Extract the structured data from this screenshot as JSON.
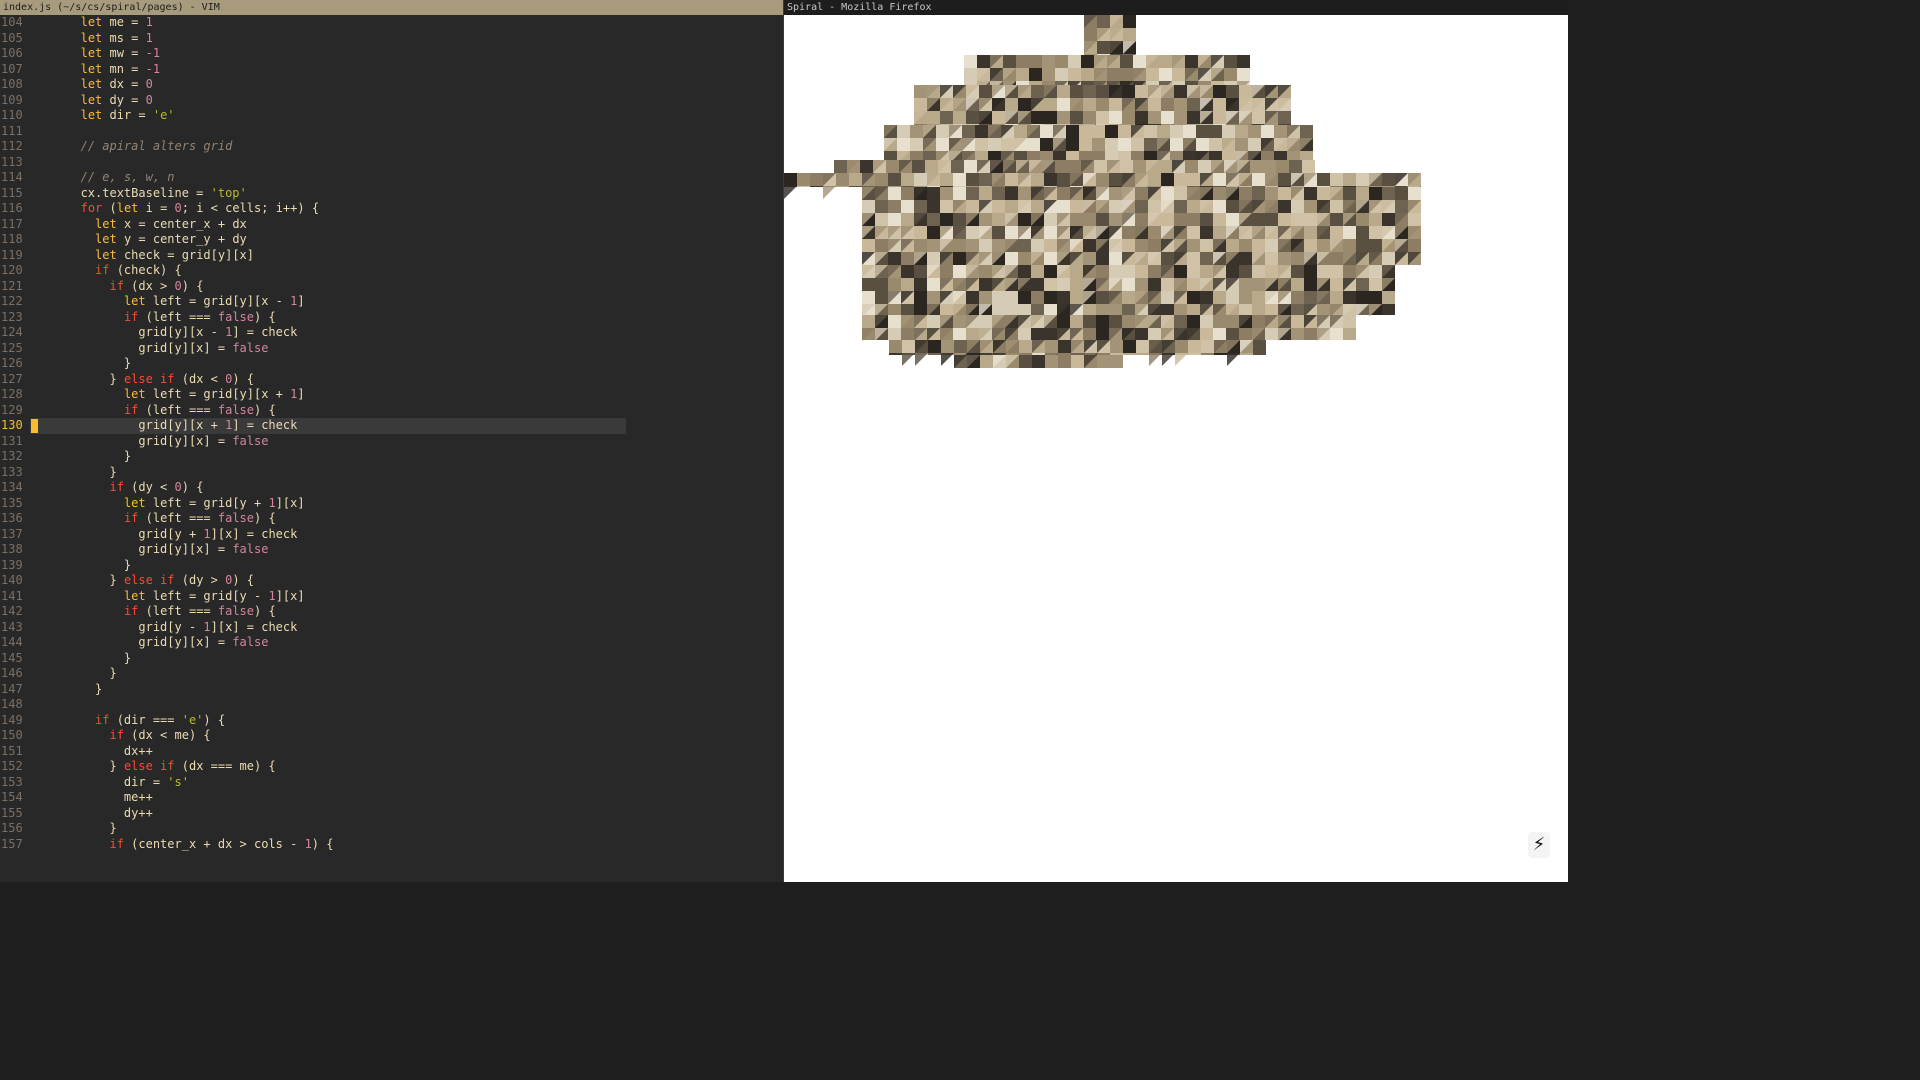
{
  "vim": {
    "title": "index.js (~/s/cs/spiral/pages) - VIM",
    "current_line": 130,
    "lines": [
      {
        "n": "104",
        "t": [
          [
            "      ",
            ""
          ],
          [
            "let",
            "ky"
          ],
          [
            " me = ",
            ""
          ],
          [
            "1",
            "num"
          ]
        ]
      },
      {
        "n": "105",
        "t": [
          [
            "      ",
            ""
          ],
          [
            "let",
            "ky"
          ],
          [
            " ms = ",
            ""
          ],
          [
            "1",
            "num"
          ]
        ]
      },
      {
        "n": "106",
        "t": [
          [
            "      ",
            ""
          ],
          [
            "let",
            "ky"
          ],
          [
            " mw = ",
            ""
          ],
          [
            "-1",
            "num"
          ]
        ]
      },
      {
        "n": "107",
        "t": [
          [
            "      ",
            ""
          ],
          [
            "let",
            "ky"
          ],
          [
            " mn = ",
            ""
          ],
          [
            "-1",
            "num"
          ]
        ]
      },
      {
        "n": "108",
        "t": [
          [
            "      ",
            ""
          ],
          [
            "let",
            "ky"
          ],
          [
            " dx = ",
            ""
          ],
          [
            "0",
            "num"
          ]
        ]
      },
      {
        "n": "109",
        "t": [
          [
            "      ",
            ""
          ],
          [
            "let",
            "ky"
          ],
          [
            " dy = ",
            ""
          ],
          [
            "0",
            "num"
          ]
        ]
      },
      {
        "n": "110",
        "t": [
          [
            "      ",
            ""
          ],
          [
            "let",
            "ky"
          ],
          [
            " dir = ",
            ""
          ],
          [
            "'e'",
            "str"
          ]
        ]
      },
      {
        "n": "111",
        "t": []
      },
      {
        "n": "112",
        "t": [
          [
            "      ",
            ""
          ],
          [
            "// apiral alters grid",
            "cm"
          ]
        ]
      },
      {
        "n": "113",
        "t": []
      },
      {
        "n": "114",
        "t": [
          [
            "      ",
            ""
          ],
          [
            "// e, s, w, n",
            "cm"
          ]
        ]
      },
      {
        "n": "115",
        "t": [
          [
            "      cx.textBaseline = ",
            ""
          ],
          [
            "'top'",
            "str"
          ]
        ]
      },
      {
        "n": "116",
        "t": [
          [
            "      ",
            ""
          ],
          [
            "for",
            "kw"
          ],
          [
            " (",
            ""
          ],
          [
            "let",
            "ky"
          ],
          [
            " i = ",
            ""
          ],
          [
            "0",
            "num"
          ],
          [
            "; i < cells; i++) {",
            ""
          ]
        ]
      },
      {
        "n": "117",
        "t": [
          [
            "        ",
            ""
          ],
          [
            "let",
            "ky"
          ],
          [
            " x = center_x + dx",
            ""
          ]
        ]
      },
      {
        "n": "118",
        "t": [
          [
            "        ",
            ""
          ],
          [
            "let",
            "ky"
          ],
          [
            " y = center_y + dy",
            ""
          ]
        ]
      },
      {
        "n": "119",
        "t": [
          [
            "        ",
            ""
          ],
          [
            "let",
            "ky"
          ],
          [
            " check = grid[y][x]",
            ""
          ]
        ]
      },
      {
        "n": "120",
        "t": [
          [
            "        ",
            ""
          ],
          [
            "if",
            "kw"
          ],
          [
            " (check) {",
            ""
          ]
        ]
      },
      {
        "n": "121",
        "t": [
          [
            "          ",
            ""
          ],
          [
            "if",
            "kw"
          ],
          [
            " (dx > ",
            ""
          ],
          [
            "0",
            "num"
          ],
          [
            ") {",
            ""
          ]
        ]
      },
      {
        "n": "122",
        "t": [
          [
            "            ",
            ""
          ],
          [
            "let",
            "ky"
          ],
          [
            " left = grid[y][x - ",
            ""
          ],
          [
            "1",
            "num"
          ],
          [
            "]",
            ""
          ]
        ]
      },
      {
        "n": "123",
        "t": [
          [
            "            ",
            ""
          ],
          [
            "if",
            "kw"
          ],
          [
            " (left === ",
            ""
          ],
          [
            "false",
            "fb"
          ],
          [
            ") {",
            ""
          ]
        ]
      },
      {
        "n": "124",
        "t": [
          [
            "              grid[y][x - ",
            ""
          ],
          [
            "1",
            "num"
          ],
          [
            "] = check",
            ""
          ]
        ]
      },
      {
        "n": "125",
        "t": [
          [
            "              grid[y][x] = ",
            ""
          ],
          [
            "false",
            "fb"
          ]
        ]
      },
      {
        "n": "126",
        "t": [
          [
            "            }",
            ""
          ]
        ]
      },
      {
        "n": "127",
        "t": [
          [
            "          } ",
            ""
          ],
          [
            "else if",
            "kw"
          ],
          [
            " (dx < ",
            ""
          ],
          [
            "0",
            "num"
          ],
          [
            ") {",
            ""
          ]
        ]
      },
      {
        "n": "128",
        "t": [
          [
            "            ",
            ""
          ],
          [
            "let",
            "ky"
          ],
          [
            " left = grid[y][x + ",
            ""
          ],
          [
            "1",
            "num"
          ],
          [
            "]",
            ""
          ]
        ]
      },
      {
        "n": "129",
        "t": [
          [
            "            ",
            ""
          ],
          [
            "if",
            "kw"
          ],
          [
            " (left === ",
            ""
          ],
          [
            "false",
            "fb"
          ],
          [
            ") {",
            ""
          ]
        ]
      },
      {
        "n": "130",
        "t": [
          [
            "              grid[y][x + ",
            ""
          ],
          [
            "1",
            "num"
          ],
          [
            "] = check",
            ""
          ]
        ]
      },
      {
        "n": "131",
        "t": [
          [
            "              grid[y][x] = ",
            ""
          ],
          [
            "false",
            "fb"
          ]
        ]
      },
      {
        "n": "132",
        "t": [
          [
            "            }",
            ""
          ]
        ]
      },
      {
        "n": "133",
        "t": [
          [
            "          }",
            ""
          ]
        ]
      },
      {
        "n": "134",
        "t": [
          [
            "          ",
            ""
          ],
          [
            "if",
            "kw"
          ],
          [
            " (dy < ",
            ""
          ],
          [
            "0",
            "num"
          ],
          [
            ") {",
            ""
          ]
        ]
      },
      {
        "n": "135",
        "t": [
          [
            "            ",
            ""
          ],
          [
            "let",
            "ky"
          ],
          [
            " left = grid[y + ",
            ""
          ],
          [
            "1",
            "num"
          ],
          [
            "][x]",
            ""
          ]
        ]
      },
      {
        "n": "136",
        "t": [
          [
            "            ",
            ""
          ],
          [
            "if",
            "kw"
          ],
          [
            " (left === ",
            ""
          ],
          [
            "false",
            "fb"
          ],
          [
            ") {",
            ""
          ]
        ]
      },
      {
        "n": "137",
        "t": [
          [
            "              grid[y + ",
            ""
          ],
          [
            "1",
            "num"
          ],
          [
            "][x] = check",
            ""
          ]
        ]
      },
      {
        "n": "138",
        "t": [
          [
            "              grid[y][x] = ",
            ""
          ],
          [
            "false",
            "fb"
          ]
        ]
      },
      {
        "n": "139",
        "t": [
          [
            "            }",
            ""
          ]
        ]
      },
      {
        "n": "140",
        "t": [
          [
            "          } ",
            ""
          ],
          [
            "else if",
            "kw"
          ],
          [
            " (dy > ",
            ""
          ],
          [
            "0",
            "num"
          ],
          [
            ") {",
            ""
          ]
        ]
      },
      {
        "n": "141",
        "t": [
          [
            "            ",
            ""
          ],
          [
            "let",
            "ky"
          ],
          [
            " left = grid[y - ",
            ""
          ],
          [
            "1",
            "num"
          ],
          [
            "][x]",
            ""
          ]
        ]
      },
      {
        "n": "142",
        "t": [
          [
            "            ",
            ""
          ],
          [
            "if",
            "kw"
          ],
          [
            " (left === ",
            ""
          ],
          [
            "false",
            "fb"
          ],
          [
            ") {",
            ""
          ]
        ]
      },
      {
        "n": "143",
        "t": [
          [
            "              grid[y - ",
            ""
          ],
          [
            "1",
            "num"
          ],
          [
            "][x] = check",
            ""
          ]
        ]
      },
      {
        "n": "144",
        "t": [
          [
            "              grid[y][x] = ",
            ""
          ],
          [
            "false",
            "fb"
          ]
        ]
      },
      {
        "n": "145",
        "t": [
          [
            "            }",
            ""
          ]
        ]
      },
      {
        "n": "146",
        "t": [
          [
            "          }",
            ""
          ]
        ]
      },
      {
        "n": "147",
        "t": [
          [
            "        }",
            ""
          ]
        ]
      },
      {
        "n": "148",
        "t": []
      },
      {
        "n": "149",
        "t": [
          [
            "        ",
            ""
          ],
          [
            "if",
            "kw"
          ],
          [
            " (dir === ",
            ""
          ],
          [
            "'e'",
            "str"
          ],
          [
            ") {",
            ""
          ]
        ]
      },
      {
        "n": "150",
        "t": [
          [
            "          ",
            ""
          ],
          [
            "if",
            "kw"
          ],
          [
            " (dx < me) {",
            ""
          ]
        ]
      },
      {
        "n": "151",
        "t": [
          [
            "            dx++",
            ""
          ]
        ]
      },
      {
        "n": "152",
        "t": [
          [
            "          } ",
            ""
          ],
          [
            "else if",
            "kw"
          ],
          [
            " (dx === me) {",
            ""
          ]
        ]
      },
      {
        "n": "153",
        "t": [
          [
            "            dir = ",
            ""
          ],
          [
            "'s'",
            "str"
          ]
        ]
      },
      {
        "n": "154",
        "t": [
          [
            "            me++",
            ""
          ]
        ]
      },
      {
        "n": "155",
        "t": [
          [
            "            dy++",
            ""
          ]
        ]
      },
      {
        "n": "156",
        "t": [
          [
            "          }",
            ""
          ]
        ]
      },
      {
        "n": "157",
        "t": [
          [
            "          ",
            ""
          ],
          [
            "if",
            "kw"
          ],
          [
            " (center_x + dx > cols - ",
            ""
          ],
          [
            "1",
            "num"
          ],
          [
            ") {",
            ""
          ]
        ]
      }
    ]
  },
  "firefox": {
    "title": "Spiral - Mozilla Firefox",
    "bolt_icon": "⚡"
  }
}
